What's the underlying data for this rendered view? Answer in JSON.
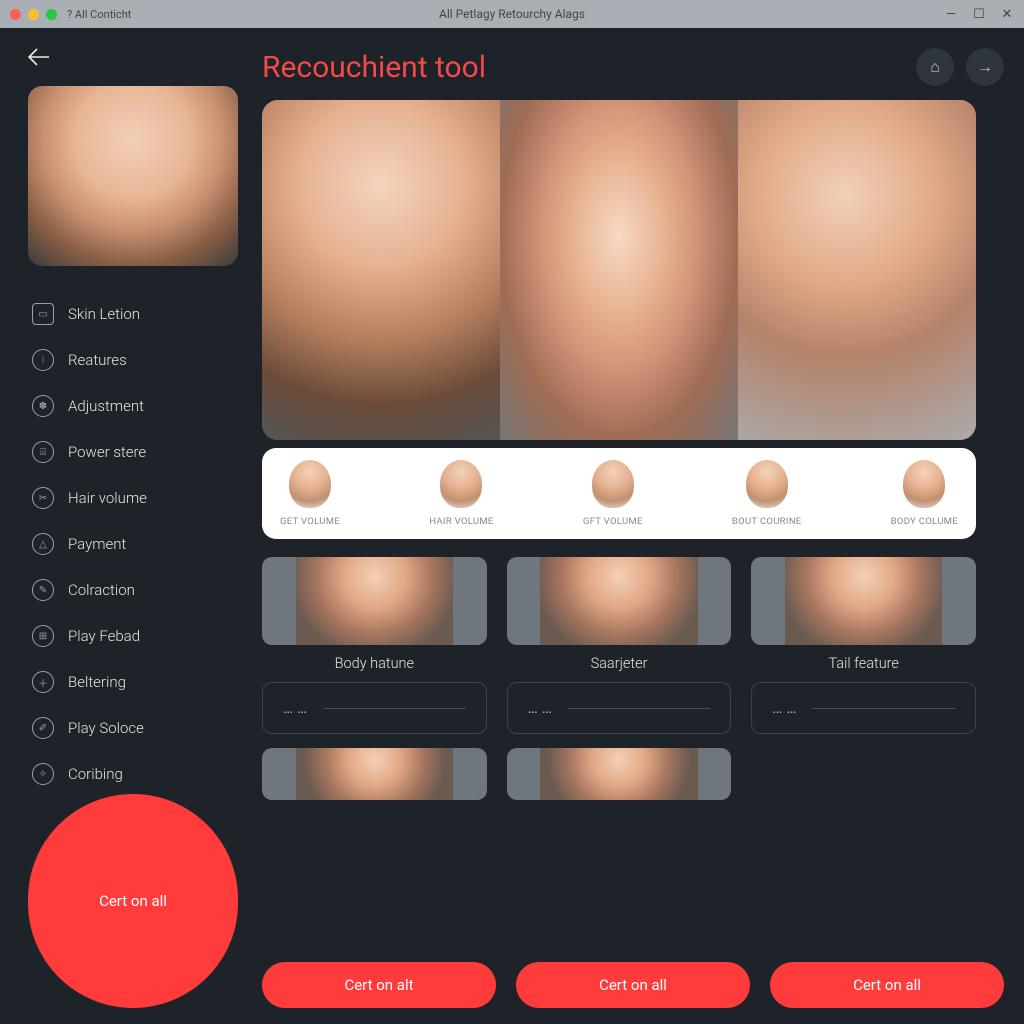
{
  "titlebar": {
    "left_text": "? All Conticht",
    "center_text": "All Petlagy Retourchy Alags"
  },
  "page_title": "Recouchient tool",
  "sidebar": {
    "items": [
      {
        "label": "Skin Letion",
        "icon": "layers"
      },
      {
        "label": "Reatures",
        "icon": "info"
      },
      {
        "label": "Adjustment",
        "icon": "gear"
      },
      {
        "label": "Power stere",
        "icon": "post"
      },
      {
        "label": "Hair volume",
        "icon": "cut"
      },
      {
        "label": "Payment",
        "icon": "warn"
      },
      {
        "label": "Colraction",
        "icon": "brush"
      },
      {
        "label": "Play Febad",
        "icon": "grid"
      },
      {
        "label": "Beltering",
        "icon": "add"
      },
      {
        "label": "Play Soloce",
        "icon": "pen"
      },
      {
        "label": "Coribing",
        "icon": "wand"
      }
    ],
    "button_label": "Cert on all"
  },
  "presets": [
    {
      "label": "GET VOLUME"
    },
    {
      "label": "HAIR VOLUME"
    },
    {
      "label": "GFT VOLUME"
    },
    {
      "label": "BOUT COURINE"
    },
    {
      "label": "BODY COLUME"
    }
  ],
  "cards": [
    {
      "label": "Body hatune"
    },
    {
      "label": "Saarjeter"
    },
    {
      "label": "Tail feature"
    }
  ],
  "slider_placeholder": "……",
  "bottom_buttons": [
    {
      "label": "Cert on alt"
    },
    {
      "label": "Cert on all"
    },
    {
      "label": "Cert on all"
    }
  ]
}
